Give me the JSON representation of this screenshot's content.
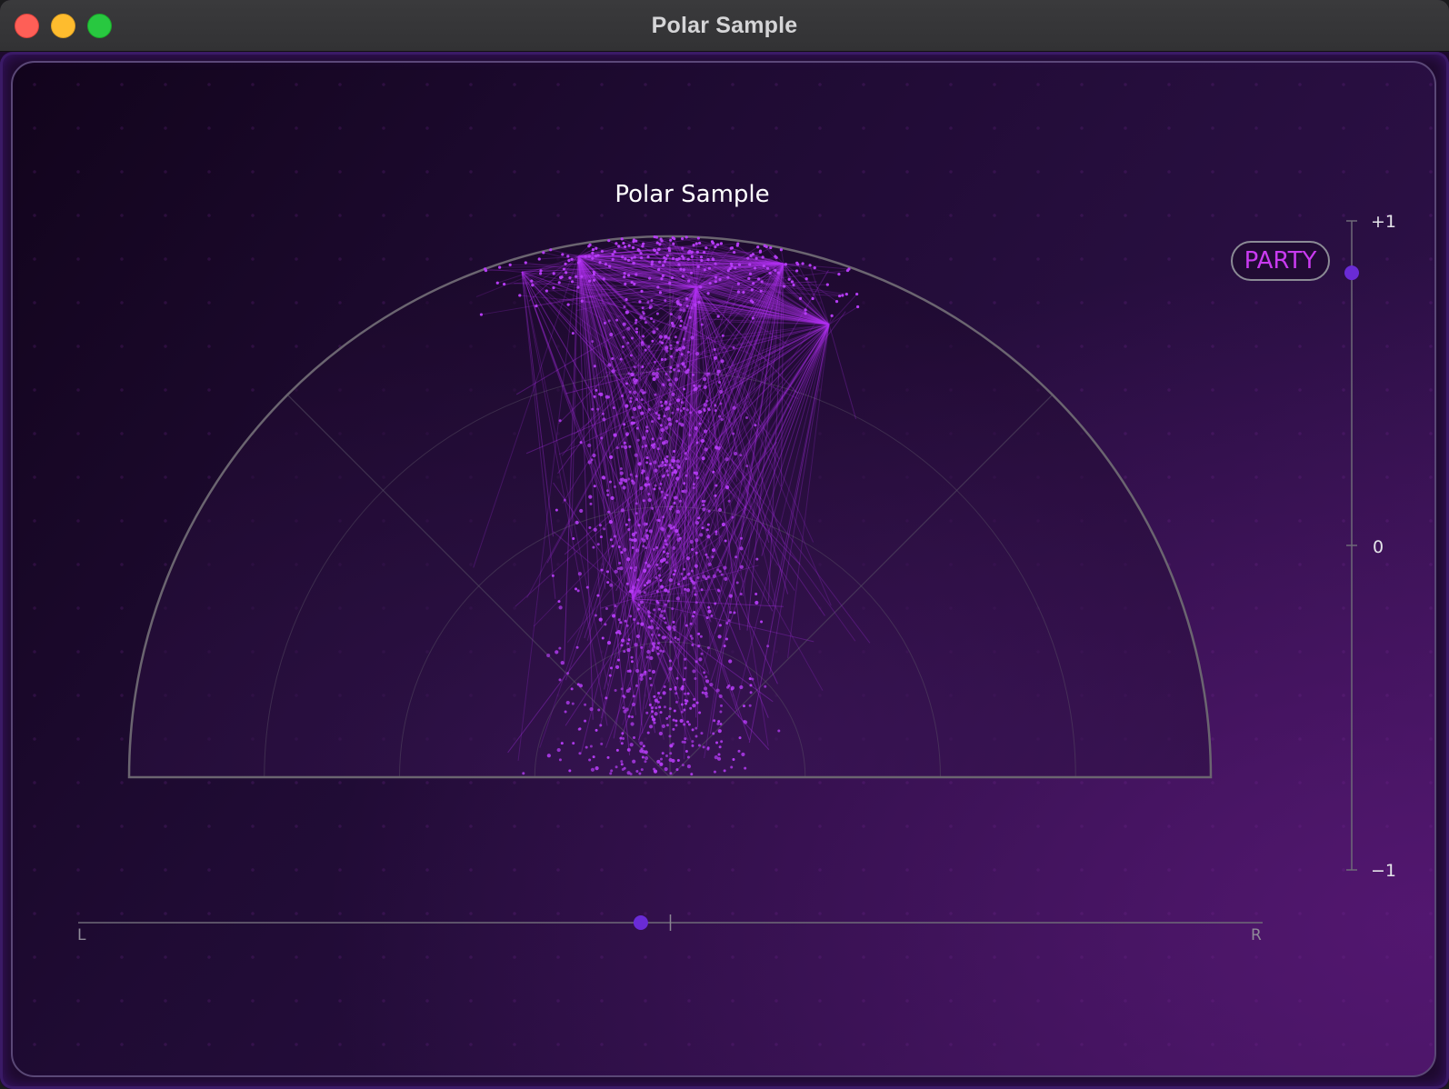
{
  "window": {
    "title": "Polar Sample"
  },
  "chart": {
    "title": "Polar Sample"
  },
  "party_button": {
    "label": "PARTY"
  },
  "vertical_meter": {
    "top_label": "+1",
    "mid_label": "0",
    "bottom_label": "−1",
    "value": 0.84
  },
  "balance_slider": {
    "left_label": "L",
    "right_label": "R",
    "value": -0.05
  },
  "colors": {
    "accent": "#b030f0",
    "dot": "#b53cf5",
    "knob": "#6a2bd6",
    "grid": "#5a5466",
    "close": "#fe5f57",
    "minimize": "#febc2e",
    "maximize": "#28c840"
  },
  "icons": {
    "close": "close-dot-icon",
    "minimize": "minimize-dot-icon",
    "maximize": "maximize-dot-icon"
  }
}
